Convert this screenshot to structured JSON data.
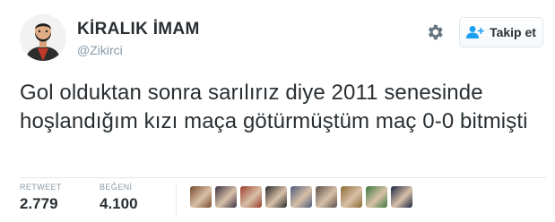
{
  "user": {
    "display_name": "KİRALIK İMAM",
    "handle": "@Zikirci",
    "avatar": "bearded-man-avatar"
  },
  "header": {
    "settings_icon": "gear-icon",
    "follow_icon": "add-user-icon",
    "follow_label": "Takip et"
  },
  "tweet": {
    "text": "Gol olduktan sonra sarılırız diye 2011 senesinde hoşlandığım kızı maça götürmüştüm maç 0-0 bitmişti"
  },
  "stats": {
    "retweet_label": "RETWEET",
    "retweet_count": "2.779",
    "like_label": "BEĞENİ",
    "like_count": "4.100"
  },
  "likers": [
    {
      "name": "liker-avatar-1",
      "color": "#7a4a2c"
    },
    {
      "name": "liker-avatar-2",
      "color": "#3a3040"
    },
    {
      "name": "liker-avatar-3",
      "color": "#9a3b2a"
    },
    {
      "name": "liker-avatar-4",
      "color": "#2a2a2a"
    },
    {
      "name": "liker-avatar-5",
      "color": "#4a5a7a"
    },
    {
      "name": "liker-avatar-6",
      "color": "#5a5048"
    },
    {
      "name": "liker-avatar-7",
      "color": "#8a6a30"
    },
    {
      "name": "liker-avatar-8",
      "color": "#3a7a3a"
    },
    {
      "name": "liker-avatar-9",
      "color": "#1a2440"
    }
  ],
  "colors": {
    "text": "#292f33",
    "muted": "#8899a6",
    "border": "#e1e8ed"
  }
}
